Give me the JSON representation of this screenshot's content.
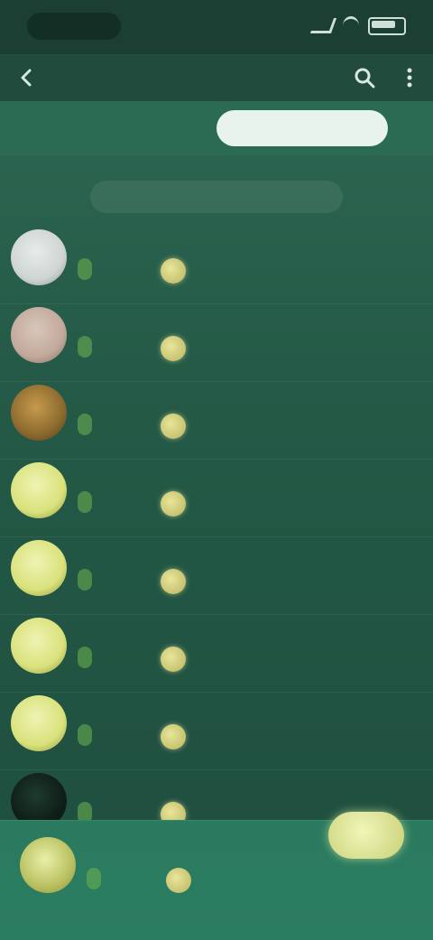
{
  "status_bar": {
    "time": "",
    "battery": ""
  },
  "app_bar": {
    "title": ""
  },
  "tabs": [
    {
      "label": ""
    },
    {
      "label": ""
    }
  ],
  "section": {
    "label": ""
  },
  "rows": [
    {
      "name": "",
      "price": "",
      "meta_top": "",
      "meta_bottom": "",
      "avatar_color": "#cfd5d2"
    },
    {
      "name": "",
      "price": "",
      "meta_top": "",
      "meta_bottom": "",
      "avatar_color": "#c2a99b"
    },
    {
      "name": "",
      "price": "",
      "meta_top": "",
      "meta_bottom": "",
      "avatar_color": "#8b6a2f"
    },
    {
      "name": "",
      "price": "",
      "meta_top": "",
      "meta_bottom": "",
      "avatar_color": "#d9e27c"
    },
    {
      "name": "",
      "price": "",
      "meta_top": "",
      "meta_bottom": "",
      "avatar_color": "#d9e27c"
    },
    {
      "name": "",
      "price": "",
      "meta_top": "",
      "meta_bottom": "",
      "avatar_color": "#d9e27c"
    },
    {
      "name": "",
      "price": "",
      "meta_top": "",
      "meta_bottom": "",
      "avatar_color": "#d9e27c"
    },
    {
      "name": "",
      "price": "",
      "meta_top": "",
      "meta_bottom": "",
      "avatar_color": "#0f1f18"
    }
  ],
  "now_playing": {
    "name": "",
    "price": "",
    "meta": "",
    "button": ""
  },
  "colors": {
    "accent": "#2a6b52",
    "background": "#245a47"
  },
  "icons": {
    "back": "back-arrow-icon",
    "search": "search-icon",
    "more": "more-icon",
    "coin": "coin-icon"
  }
}
